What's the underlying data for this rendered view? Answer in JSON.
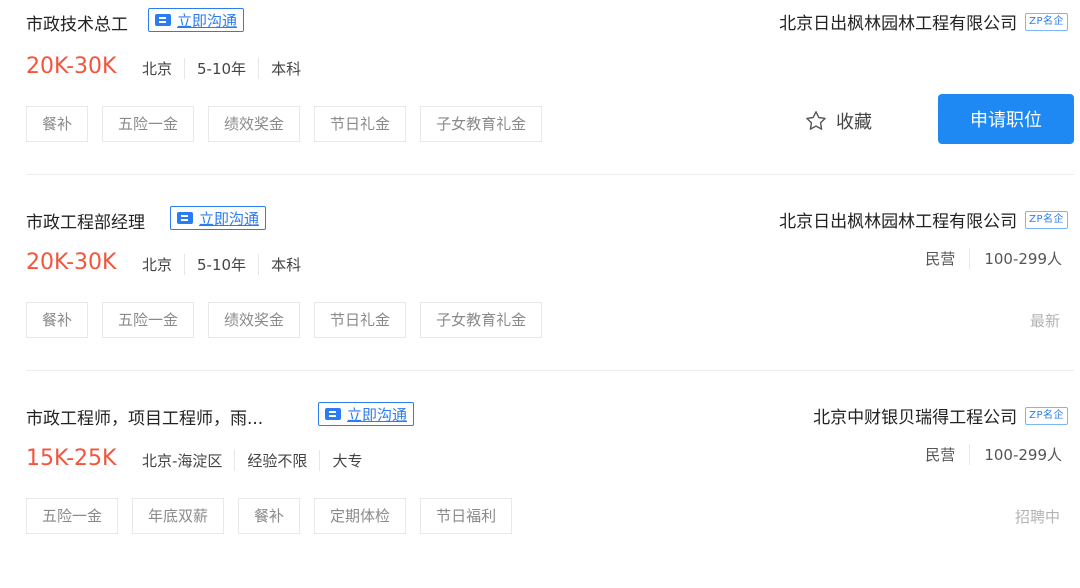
{
  "jobs": [
    {
      "title": "市政技术总工",
      "chat_label": "立即沟通",
      "salary": "20K-30K",
      "meta": [
        "北京",
        "5-10年",
        "本科"
      ],
      "tags": [
        "餐补",
        "五险一金",
        "绩效奖金",
        "节日礼金",
        "子女教育礼金"
      ],
      "company": "北京日出枫林园林工程有限公司",
      "badge": "ZP名企",
      "favorite_label": "收藏",
      "apply_label": "申请职位"
    },
    {
      "title": "市政工程部经理",
      "chat_label": "立即沟通",
      "salary": "20K-30K",
      "meta": [
        "北京",
        "5-10年",
        "本科"
      ],
      "tags": [
        "餐补",
        "五险一金",
        "绩效奖金",
        "节日礼金",
        "子女教育礼金"
      ],
      "company": "北京日出枫林园林工程有限公司",
      "badge": "ZP名企",
      "company_info": [
        "民营",
        "100-299人"
      ],
      "status": "最新"
    },
    {
      "title": "市政工程师，项目工程师，雨...",
      "chat_label": "立即沟通",
      "salary": "15K-25K",
      "meta": [
        "北京-海淀区",
        "经验不限",
        "大专"
      ],
      "tags": [
        "五险一金",
        "年底双薪",
        "餐补",
        "定期体检",
        "节日福利"
      ],
      "company": "北京中财银贝瑞得工程公司",
      "badge": "ZP名企",
      "company_info": [
        "民营",
        "100-299人"
      ],
      "status": "招聘中"
    }
  ],
  "colors": {
    "accent": "#2b7cf0",
    "salary": "#f4543c",
    "apply_button": "#1e88f3"
  },
  "icons": [
    "chat-icon",
    "star-icon"
  ]
}
